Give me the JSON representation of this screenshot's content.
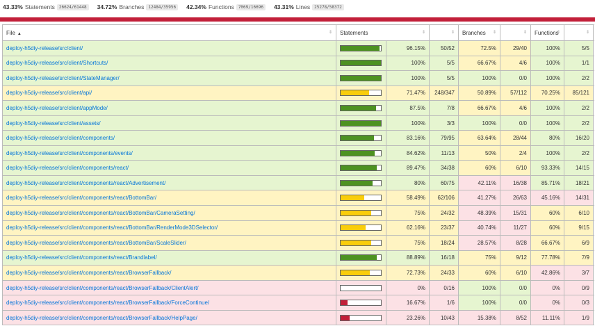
{
  "summary": [
    {
      "pct": "43.33%",
      "label": "Statements",
      "frac": "26624/61448"
    },
    {
      "pct": "34.72%",
      "label": "Branches",
      "frac": "12484/35956"
    },
    {
      "pct": "42.34%",
      "label": "Functions",
      "frac": "7069/16696"
    },
    {
      "pct": "43.31%",
      "label": "Lines",
      "frac": "25278/58372"
    }
  ],
  "headers": {
    "file": "File",
    "statements": "Statements",
    "branches": "Branches",
    "functions": "Functions"
  },
  "colors": {
    "high": "#e6f5d0",
    "medium": "#fff4c2",
    "low": "#fce1e5",
    "fill_high": "#4d9221",
    "fill_medium": "#f9cd0b",
    "fill_low": "#c21f39",
    "status_bar": "#c21f39"
  },
  "rows": [
    {
      "file": "deploy-h5diy-release/src/client/",
      "level": "high",
      "fill": 0.9615,
      "stmt_pct": "96.15%",
      "stmt_frac": "50/52",
      "br_pct": "72.5%",
      "br_frac": "29/40",
      "br_level": "medium",
      "fn_pct": "100%",
      "fn_frac": "5/5",
      "fn_level": "high"
    },
    {
      "file": "deploy-h5diy-release/src/client/Shortcuts/",
      "level": "high",
      "fill": 1.0,
      "stmt_pct": "100%",
      "stmt_frac": "5/5",
      "br_pct": "66.67%",
      "br_frac": "4/6",
      "br_level": "medium",
      "fn_pct": "100%",
      "fn_frac": "1/1",
      "fn_level": "high"
    },
    {
      "file": "deploy-h5diy-release/src/client/StateManager/",
      "level": "high",
      "fill": 1.0,
      "stmt_pct": "100%",
      "stmt_frac": "5/5",
      "br_pct": "100%",
      "br_frac": "0/0",
      "br_level": "high",
      "fn_pct": "100%",
      "fn_frac": "2/2",
      "fn_level": "high"
    },
    {
      "file": "deploy-h5diy-release/src/client/api/",
      "level": "medium",
      "fill": 0.7147,
      "stmt_pct": "71.47%",
      "stmt_frac": "248/347",
      "br_pct": "50.89%",
      "br_frac": "57/112",
      "br_level": "medium",
      "fn_pct": "70.25%",
      "fn_frac": "85/121",
      "fn_level": "medium"
    },
    {
      "file": "deploy-h5diy-release/src/client/appMode/",
      "level": "high",
      "fill": 0.875,
      "stmt_pct": "87.5%",
      "stmt_frac": "7/8",
      "br_pct": "66.67%",
      "br_frac": "4/6",
      "br_level": "medium",
      "fn_pct": "100%",
      "fn_frac": "2/2",
      "fn_level": "high"
    },
    {
      "file": "deploy-h5diy-release/src/client/assets/",
      "level": "high",
      "fill": 1.0,
      "stmt_pct": "100%",
      "stmt_frac": "3/3",
      "br_pct": "100%",
      "br_frac": "0/0",
      "br_level": "high",
      "fn_pct": "100%",
      "fn_frac": "2/2",
      "fn_level": "high"
    },
    {
      "file": "deploy-h5diy-release/src/client/components/",
      "level": "high",
      "fill": 0.8316,
      "stmt_pct": "83.16%",
      "stmt_frac": "79/95",
      "br_pct": "63.64%",
      "br_frac": "28/44",
      "br_level": "medium",
      "fn_pct": "80%",
      "fn_frac": "16/20",
      "fn_level": "high"
    },
    {
      "file": "deploy-h5diy-release/src/client/components/events/",
      "level": "high",
      "fill": 0.8462,
      "stmt_pct": "84.62%",
      "stmt_frac": "11/13",
      "br_pct": "50%",
      "br_frac": "2/4",
      "br_level": "medium",
      "fn_pct": "100%",
      "fn_frac": "2/2",
      "fn_level": "high"
    },
    {
      "file": "deploy-h5diy-release/src/client/components/react/",
      "level": "high",
      "fill": 0.8947,
      "stmt_pct": "89.47%",
      "stmt_frac": "34/38",
      "br_pct": "60%",
      "br_frac": "6/10",
      "br_level": "medium",
      "fn_pct": "93.33%",
      "fn_frac": "14/15",
      "fn_level": "high"
    },
    {
      "file": "deploy-h5diy-release/src/client/components/react/Advertisement/",
      "level": "high",
      "fill": 0.8,
      "stmt_pct": "80%",
      "stmt_frac": "60/75",
      "br_pct": "42.11%",
      "br_frac": "16/38",
      "br_level": "low",
      "fn_pct": "85.71%",
      "fn_frac": "18/21",
      "fn_level": "high"
    },
    {
      "file": "deploy-h5diy-release/src/client/components/react/BottomBar/",
      "level": "medium",
      "fill": 0.5849,
      "stmt_pct": "58.49%",
      "stmt_frac": "62/106",
      "br_pct": "41.27%",
      "br_frac": "26/63",
      "br_level": "low",
      "fn_pct": "45.16%",
      "fn_frac": "14/31",
      "fn_level": "low"
    },
    {
      "file": "deploy-h5diy-release/src/client/components/react/BottomBar/CameraSetting/",
      "level": "medium",
      "fill": 0.75,
      "stmt_pct": "75%",
      "stmt_frac": "24/32",
      "br_pct": "48.39%",
      "br_frac": "15/31",
      "br_level": "low",
      "fn_pct": "60%",
      "fn_frac": "6/10",
      "fn_level": "medium"
    },
    {
      "file": "deploy-h5diy-release/src/client/components/react/BottomBar/RenderMode3DSelector/",
      "level": "medium",
      "fill": 0.6216,
      "stmt_pct": "62.16%",
      "stmt_frac": "23/37",
      "br_pct": "40.74%",
      "br_frac": "11/27",
      "br_level": "low",
      "fn_pct": "60%",
      "fn_frac": "9/15",
      "fn_level": "medium"
    },
    {
      "file": "deploy-h5diy-release/src/client/components/react/BottomBar/ScaleSlider/",
      "level": "medium",
      "fill": 0.75,
      "stmt_pct": "75%",
      "stmt_frac": "18/24",
      "br_pct": "28.57%",
      "br_frac": "8/28",
      "br_level": "low",
      "fn_pct": "66.67%",
      "fn_frac": "6/9",
      "fn_level": "medium"
    },
    {
      "file": "deploy-h5diy-release/src/client/components/react/Brandlabel/",
      "level": "high",
      "fill": 0.8889,
      "stmt_pct": "88.89%",
      "stmt_frac": "16/18",
      "br_pct": "75%",
      "br_frac": "9/12",
      "br_level": "medium",
      "fn_pct": "77.78%",
      "fn_frac": "7/9",
      "fn_level": "medium"
    },
    {
      "file": "deploy-h5diy-release/src/client/components/react/BrowserFallback/",
      "level": "medium",
      "fill": 0.7273,
      "stmt_pct": "72.73%",
      "stmt_frac": "24/33",
      "br_pct": "60%",
      "br_frac": "6/10",
      "br_level": "medium",
      "fn_pct": "42.86%",
      "fn_frac": "3/7",
      "fn_level": "low"
    },
    {
      "file": "deploy-h5diy-release/src/client/components/react/BrowserFallback/ClientAlert/",
      "level": "low",
      "fill": 0.0,
      "stmt_pct": "0%",
      "stmt_frac": "0/16",
      "br_pct": "100%",
      "br_frac": "0/0",
      "br_level": "high",
      "fn_pct": "0%",
      "fn_frac": "0/9",
      "fn_level": "low"
    },
    {
      "file": "deploy-h5diy-release/src/client/components/react/BrowserFallback/ForceContinue/",
      "level": "low",
      "fill": 0.1667,
      "stmt_pct": "16.67%",
      "stmt_frac": "1/6",
      "br_pct": "100%",
      "br_frac": "0/0",
      "br_level": "high",
      "fn_pct": "0%",
      "fn_frac": "0/3",
      "fn_level": "low"
    },
    {
      "file": "deploy-h5diy-release/src/client/components/react/BrowserFallback/HelpPage/",
      "level": "low",
      "fill": 0.2326,
      "stmt_pct": "23.26%",
      "stmt_frac": "10/43",
      "br_pct": "15.38%",
      "br_frac": "8/52",
      "br_level": "low",
      "fn_pct": "11.11%",
      "fn_frac": "1/9",
      "fn_level": "low"
    }
  ]
}
